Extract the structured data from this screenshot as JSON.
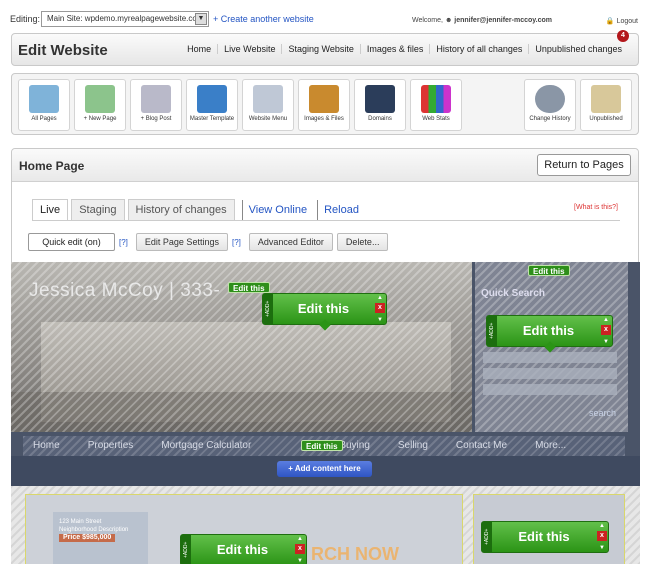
{
  "topbar": {
    "editing_label": "Editing:",
    "site_select": "Main Site: wpdemo.myrealpagewebsite.co",
    "create_link": "+ Create another website",
    "welcome_prefix": "Welcome,",
    "user_email": "jennifer@jennifer-mccoy.com",
    "logout": "Logout"
  },
  "header": {
    "title": "Edit Website",
    "nav": [
      "Home",
      "Live Website",
      "Staging Website",
      "Images & files",
      "History of all changes",
      "Unpublished changes"
    ],
    "unpublished_count": "4"
  },
  "toolbar": {
    "items": [
      {
        "label": "All Pages",
        "color": "#7fb3d9"
      },
      {
        "label": "+ New Page",
        "color": "#8cc48c"
      },
      {
        "label": "+ Blog Post",
        "color": "#b9b9c9"
      },
      {
        "label": "Master Template",
        "color": "#3a7fc8"
      },
      {
        "label": "Website Menu",
        "color": "#bfc8d6"
      },
      {
        "label": "Images & Files",
        "color": "#c98a2e"
      },
      {
        "label": "Domains",
        "color": "#2b3d5a"
      },
      {
        "label": "Web Stats",
        "color": "#c0c0c0"
      },
      {
        "label": "Change History",
        "color": "#8a96a6"
      },
      {
        "label": "Unpublished",
        "color": "#d8c89a"
      }
    ]
  },
  "page": {
    "title": "Home Page",
    "return_button": "Return to Pages",
    "tabs": [
      "Live",
      "Staging",
      "History of changes"
    ],
    "links": [
      "View Online",
      "Reload"
    ],
    "what_is_this": "[What is this?]",
    "quick_edit": "Quick edit (on)",
    "help": "[?]",
    "edit_settings": "Edit Page Settings",
    "advanced_editor": "Advanced Editor",
    "delete": "Delete..."
  },
  "preview": {
    "name": "Jessica McCoy  |  333-",
    "quick_search": "Quick Search",
    "search": "search",
    "menu": [
      "Home",
      "Properties",
      "Mortgage Calculator",
      "Buying",
      "Selling",
      "Contact Me",
      "More..."
    ],
    "add_content": "+ Add content here",
    "listing_address": "123 Main Street",
    "listing_sub": "Neighborhood Description",
    "listing_price": "Price $985,000",
    "search_now": "RCH NOW",
    "edit_label": "Edit this",
    "add_label": "+ADD+"
  }
}
